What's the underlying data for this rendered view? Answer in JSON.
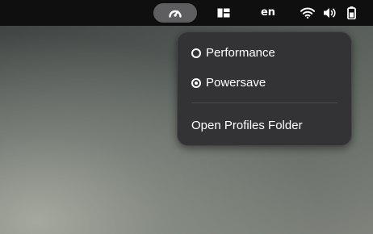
{
  "topbar": {
    "power_profile_icon": "speedometer-icon",
    "workspace_icon": "window-layout-icon",
    "keyboard_layout": "en",
    "network_icon": "wifi-icon",
    "volume_icon": "speaker-icon",
    "battery_icon": "battery-icon"
  },
  "menu": {
    "items": [
      {
        "label": "Performance",
        "checked": false
      },
      {
        "label": "Powersave",
        "checked": true
      }
    ],
    "open_folder_label": "Open Profiles Folder"
  },
  "colors": {
    "topbar_bg": "#0f0f10",
    "active_pill": "#5e5e60",
    "menu_bg": "#333336",
    "text": "#ffffff"
  }
}
